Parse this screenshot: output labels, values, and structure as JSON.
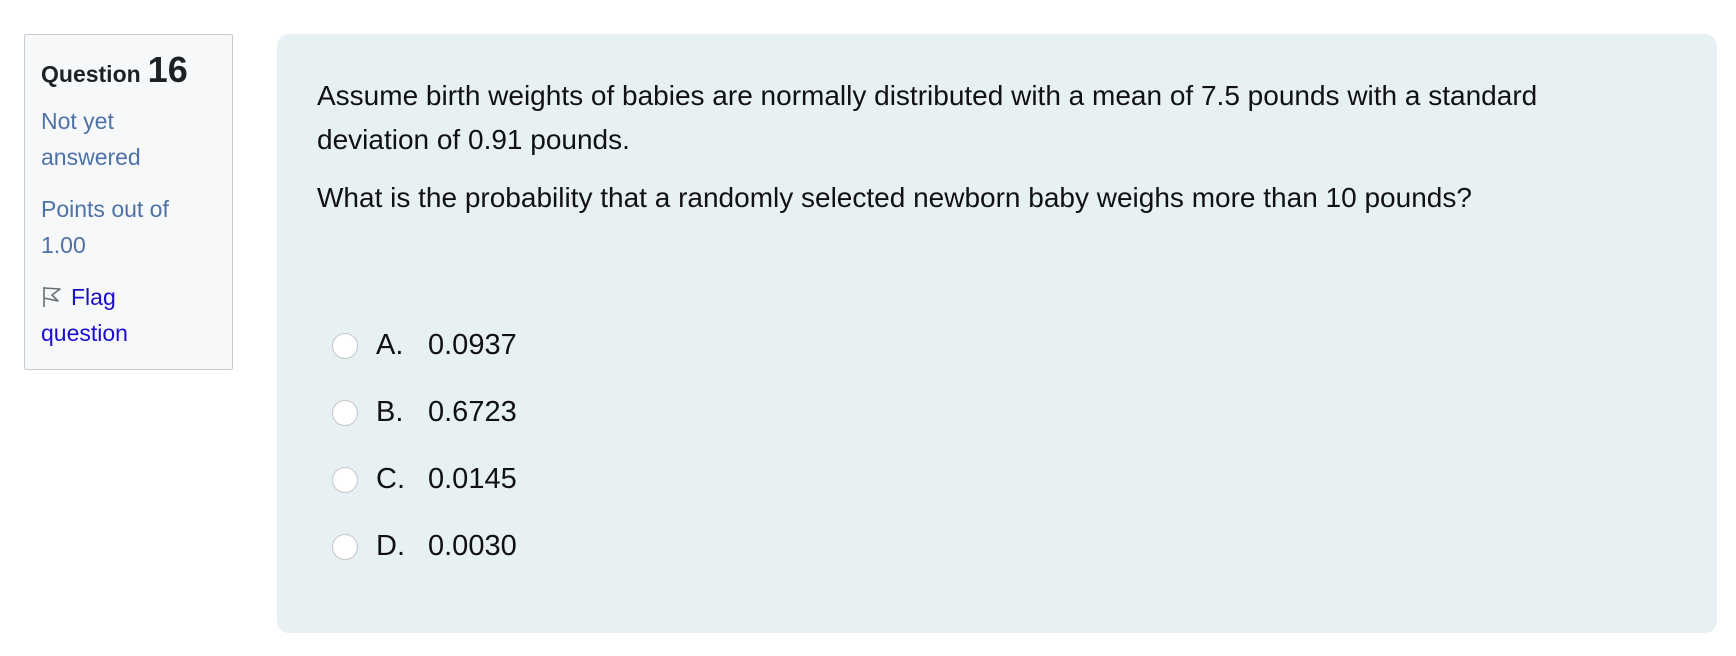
{
  "question_info": {
    "question_word": "Question",
    "question_number": "16",
    "state_line1": "Not yet",
    "state_line2": "answered",
    "grade_line1": "Points out of",
    "grade_line2": "1.00",
    "flag_line1": "Flag",
    "flag_line2": "question",
    "flag_icon": "flag-outline-icon"
  },
  "question": {
    "text_paragraph1_line1": "Assume birth weights of babies are normally distributed with a mean of 7.5 pounds with a standard",
    "text_paragraph1_line2": "deviation of 0.91 pounds.",
    "text_paragraph2": "What is the probability that a randomly selected newborn baby weighs more than 10 pounds?"
  },
  "answers": [
    {
      "letter": "A.",
      "value": "0.0937"
    },
    {
      "letter": "B.",
      "value": "0.6723"
    },
    {
      "letter": "C.",
      "value": "0.0145"
    },
    {
      "letter": "D.",
      "value": "0.0030"
    }
  ],
  "colors": {
    "info_text": "#4f72a6",
    "link": "#1a0dcf",
    "content_bg": "#e7f0f3"
  }
}
